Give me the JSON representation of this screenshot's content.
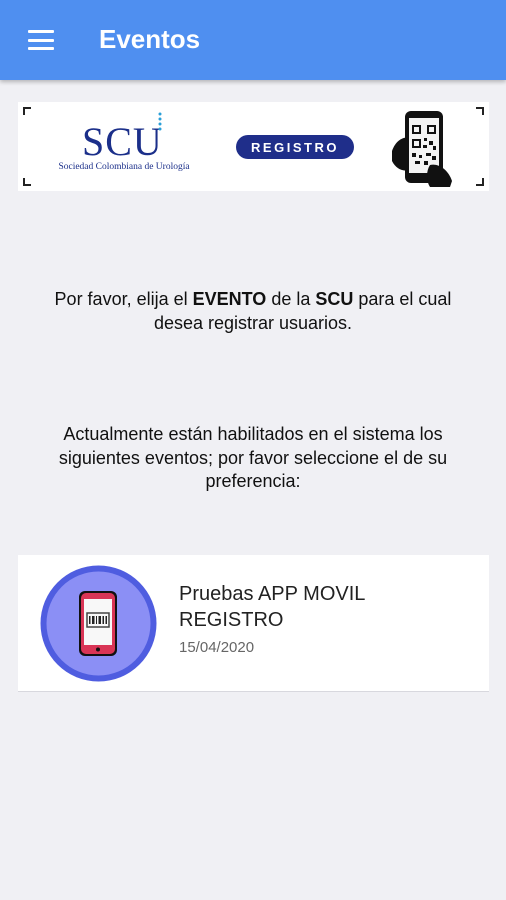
{
  "appbar": {
    "title": "Eventos",
    "menu_icon": "menu-icon",
    "color": "#4f8ff0"
  },
  "banner": {
    "logo_text": "SCU",
    "logo_subtitle": "Sociedad Colombiana de Urología",
    "registro_label": "REGISTRO",
    "phone_icon": "phone-qr-icon"
  },
  "intro": {
    "line_prefix": "Por favor, elija el ",
    "event_word": "EVENTO",
    "line_mid": " de la ",
    "scu_word": "SCU",
    "line_suffix": " para el cual desea registrar usuarios."
  },
  "info": {
    "text": "Actualmente están habilitados en el sistema los siguientes eventos; por favor seleccione el de su preferencia:"
  },
  "events": [
    {
      "title": "Pruebas APP MOVIL REGISTRO",
      "date": "15/04/2020",
      "icon": "event-phone-icon"
    }
  ]
}
